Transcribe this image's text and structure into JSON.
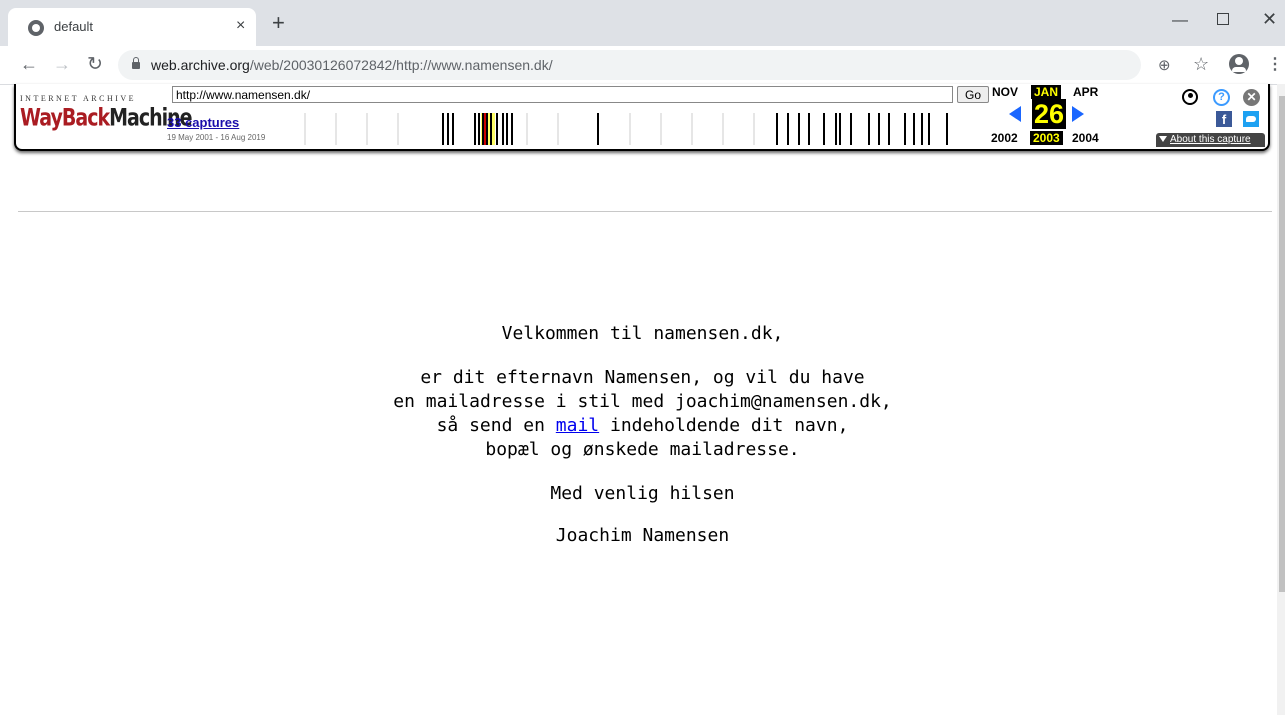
{
  "browser": {
    "tab_title": "default",
    "tab_close": "×",
    "new_tab": "+",
    "url_host": "web.archive.org",
    "url_path": "/web/20030126072842/http://www.namensen.dk/"
  },
  "wayback": {
    "ia_label": "INTERNET ARCHIVE",
    "logo_wayback": "WayBack",
    "logo_machine": "Machine",
    "url_value": "http://www.namensen.dk/",
    "go_label": "Go",
    "captures": "33 captures",
    "range": "19 May 2001 - 16 Aug 2019",
    "months": {
      "prev": "NOV",
      "current": "JAN",
      "next": "APR"
    },
    "day": "26",
    "years": {
      "prev": "2002",
      "current": "2003",
      "next": "2004"
    },
    "about_label": "About this capture",
    "help_glyph": "?",
    "close_glyph": "✕",
    "fb_glyph": "f"
  },
  "page": {
    "greeting": "Velkommen til namensen.dk,",
    "line1": "er dit efternavn Namensen, og vil du have",
    "line2": "en mailadresse i stil med joachim@namensen.dk,",
    "line3_before": "så send en ",
    "line3_link": "mail",
    "line3_after": " indeholdende dit navn,",
    "line4": "bopæl og ønskede mailadresse.",
    "closing": "Med venlig hilsen",
    "signature": "Joachim Namensen"
  }
}
